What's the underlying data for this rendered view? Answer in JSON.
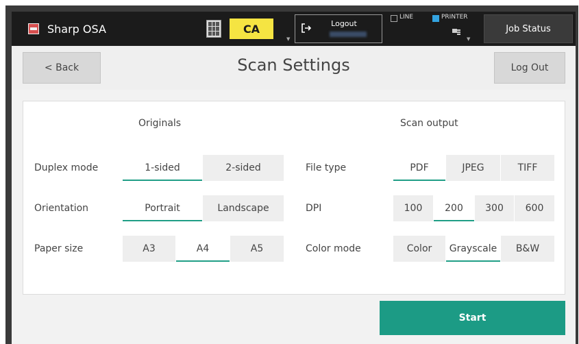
{
  "topbar": {
    "app_title": "Sharp OSA",
    "app_icon": "sharp-osa-icon",
    "keypad_icon": "keypad-icon",
    "ca_label": "CA",
    "logout_label": "Logout",
    "logout_icon": "logout-arrow-icon",
    "line_label": "LINE",
    "printer_label": "PRINTER",
    "printer_icon": "printer-icon",
    "job_status_label": "Job Status",
    "colors": {
      "bar": "#1b1b1b",
      "ca": "#f5e442",
      "printer_led": "#33a3e0"
    }
  },
  "header": {
    "back_label": "< Back",
    "title": "Scan Settings",
    "logout_label": "Log Out"
  },
  "originals": {
    "title": "Originals",
    "duplex": {
      "label": "Duplex mode",
      "options": [
        "1-sided",
        "2-sided"
      ],
      "selected": "1-sided"
    },
    "orientation": {
      "label": "Orientation",
      "options": [
        "Portrait",
        "Landscape"
      ],
      "selected": "Portrait"
    },
    "paper": {
      "label": "Paper size",
      "options": [
        "A3",
        "A4",
        "A5"
      ],
      "selected": "A4"
    }
  },
  "output": {
    "title": "Scan output",
    "filetype": {
      "label": "File type",
      "options": [
        "PDF",
        "JPEG",
        "TIFF"
      ],
      "selected": "PDF"
    },
    "dpi": {
      "label": "DPI",
      "options": [
        "100",
        "200",
        "300",
        "600"
      ],
      "selected": "200"
    },
    "color": {
      "label": "Color mode",
      "options": [
        "Color",
        "Grayscale",
        "B&W"
      ],
      "selected": "Grayscale"
    }
  },
  "start_label": "Start",
  "accent_color": "#1c9b85"
}
